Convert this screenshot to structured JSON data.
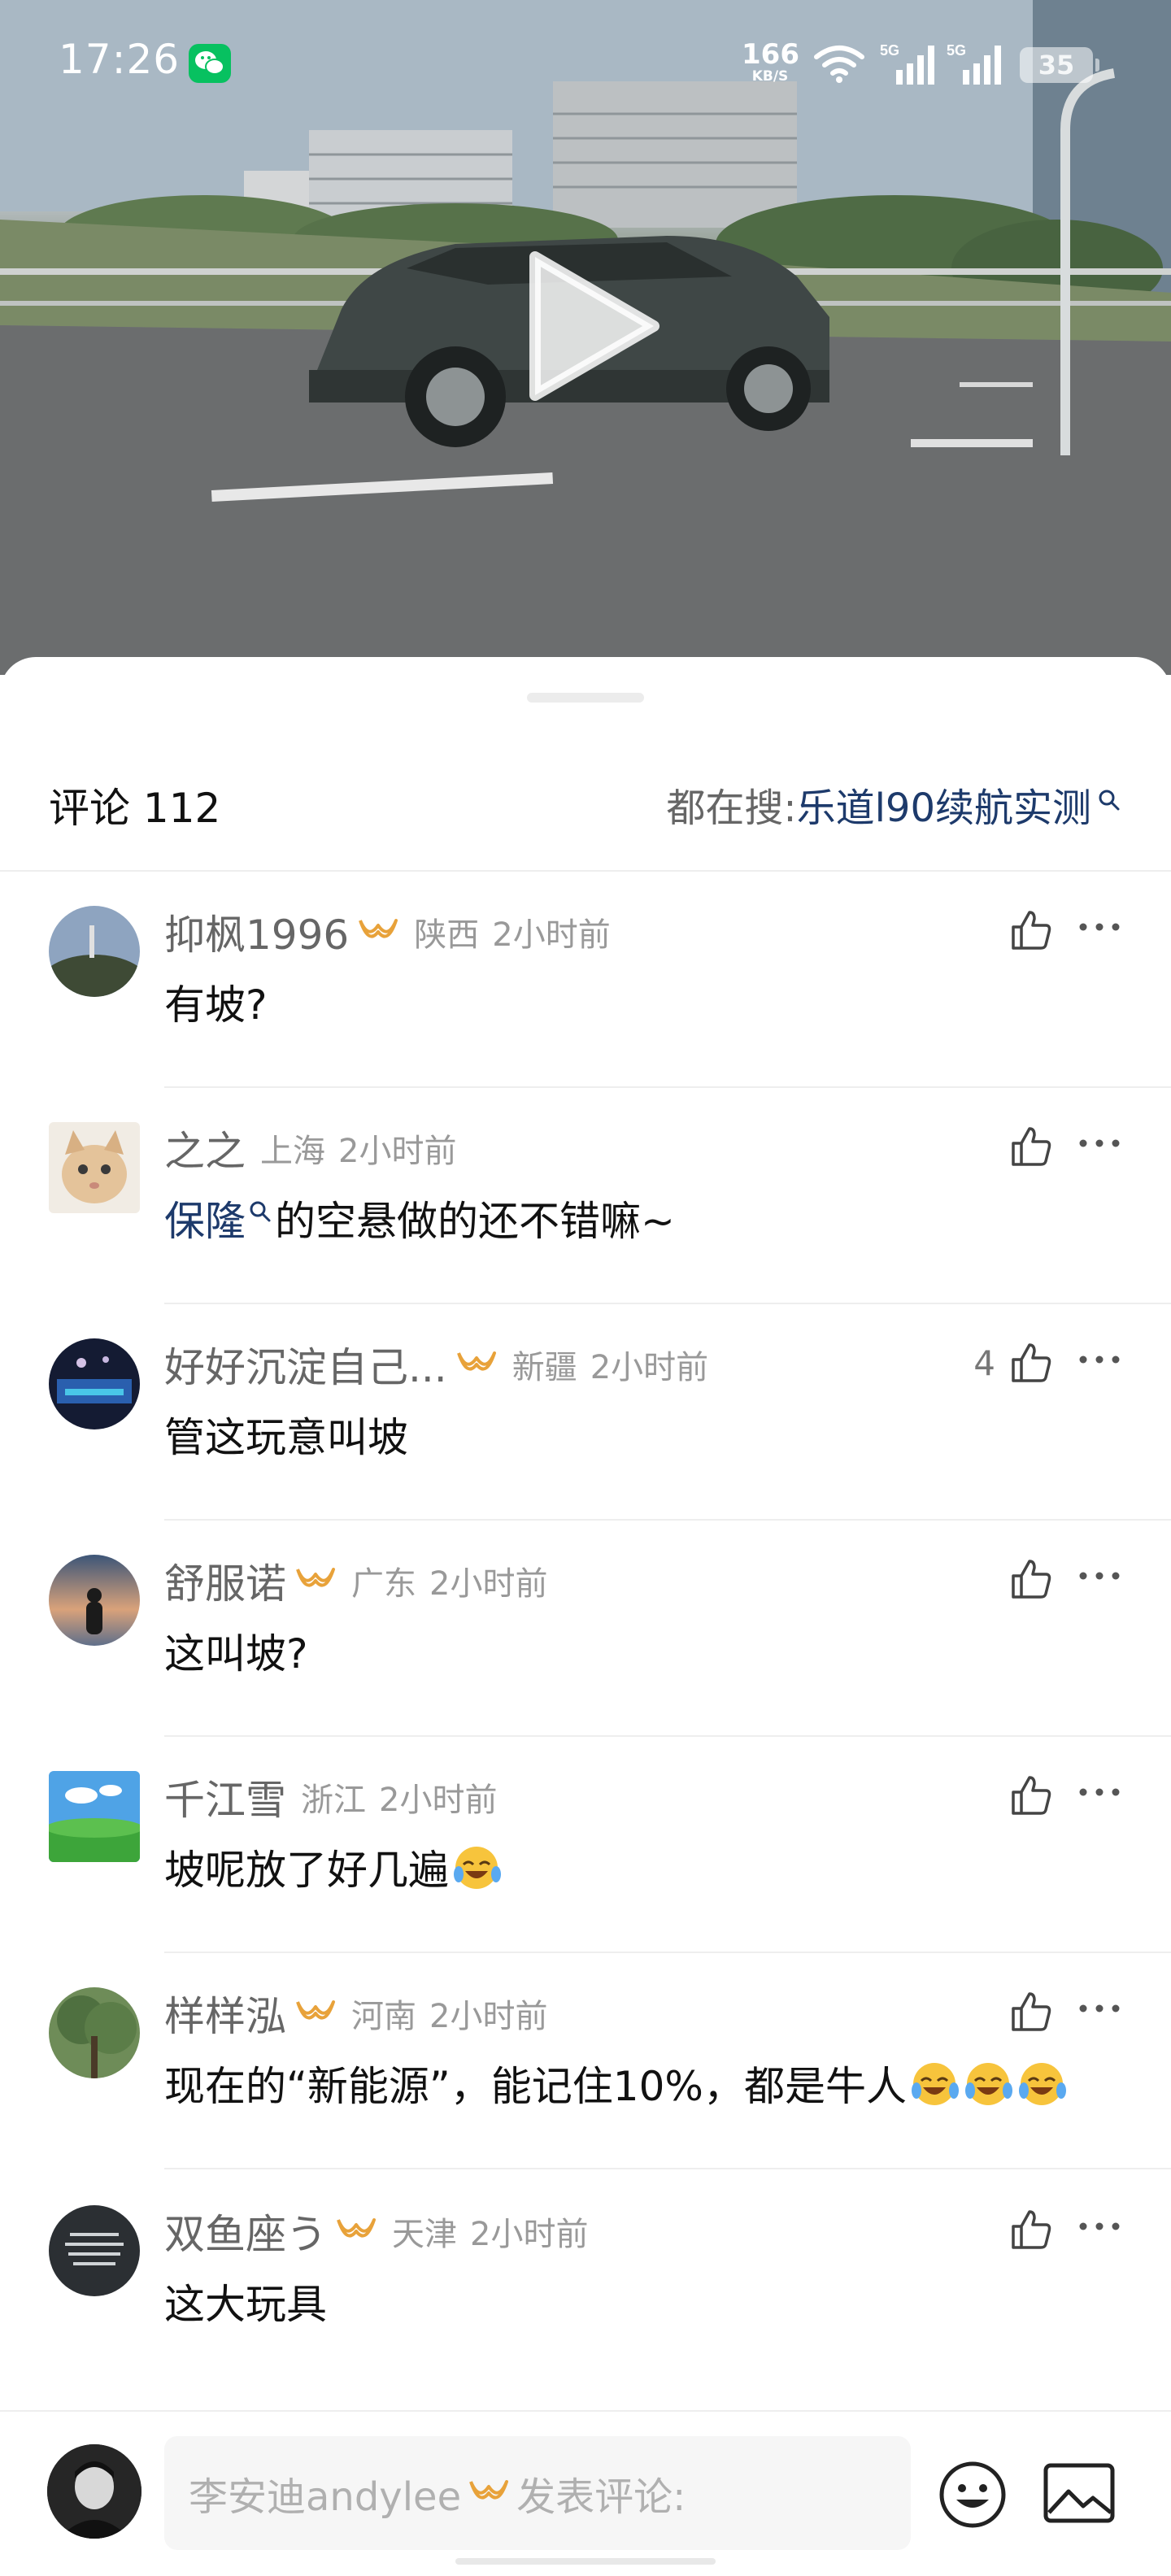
{
  "status_bar": {
    "time": "17:26",
    "net_speed": "166",
    "net_unit": "KB/S",
    "signal_1": "5G",
    "signal_2": "5G",
    "battery": "35"
  },
  "header": {
    "title": "评论 112",
    "trending_label": "都在搜:",
    "trending_term": "乐道l90续航实测"
  },
  "comments": [
    {
      "username": "抑枫1996",
      "vip": true,
      "region": "陕西",
      "time": "2小时前",
      "text": "有坡?",
      "likes": ""
    },
    {
      "username": "之之",
      "vip": false,
      "region": "上海",
      "time": "2小时前",
      "text_link": "保隆",
      "text": "的空悬做的还不错嘛~",
      "likes": ""
    },
    {
      "username": "好好沉淀自己...",
      "vip": true,
      "region": "新疆",
      "time": "2小时前",
      "text": "管这玩意叫坡",
      "likes": "4"
    },
    {
      "username": "舒服诺",
      "vip": true,
      "region": "广东",
      "time": "2小时前",
      "text": "这叫坡?",
      "likes": ""
    },
    {
      "username": "千江雪",
      "vip": false,
      "region": "浙江",
      "time": "2小时前",
      "text": "坡呢放了好几遍",
      "emoji_count": 1,
      "likes": ""
    },
    {
      "username": "样样泓",
      "vip": true,
      "region": "河南",
      "time": "2小时前",
      "text": "现在的“新能源”，能记住10%，都是牛人",
      "emoji_count": 3,
      "likes": ""
    },
    {
      "username": "双鱼座う",
      "vip": true,
      "region": "天津",
      "time": "2小时前",
      "text": "这大玩具",
      "likes": ""
    }
  ],
  "bottom_bar": {
    "user_name": "李安迪andylee",
    "prompt": "发表评论:"
  },
  "colors": {
    "vip_gold": "#e8a23a",
    "link_blue": "#1d3a6b",
    "wechat_green": "#07c160"
  },
  "icons": [
    "wechat-icon",
    "wifi-icon",
    "signal-icon",
    "play-icon",
    "search-icon",
    "vip-icon",
    "like-icon",
    "more-icon",
    "emoji-icon",
    "image-icon",
    "laugh-cry-emoji"
  ]
}
